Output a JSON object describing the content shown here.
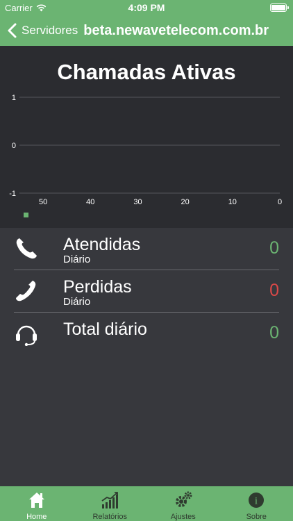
{
  "status": {
    "carrier": "Carrier",
    "time": "4:09 PM"
  },
  "nav": {
    "back_label": "Servidores",
    "title": "beta.newavetelecom.com.br"
  },
  "chart_data": {
    "type": "line",
    "title": "Chamadas Ativas",
    "x": [
      50,
      40,
      30,
      20,
      10,
      0
    ],
    "xticks": [
      "50",
      "40",
      "30",
      "20",
      "10",
      "0"
    ],
    "xlim": [
      55,
      0
    ],
    "ylim": [
      -1,
      1
    ],
    "yticks": [
      "1",
      "0",
      "-1"
    ],
    "series": [
      {
        "color": "#6bb472",
        "values": []
      }
    ],
    "grid": true,
    "legend": "bottom-left"
  },
  "stats": [
    {
      "label": "Atendidas",
      "sub": "Diário",
      "value": "0",
      "color": "green",
      "icon": "phone-icon"
    },
    {
      "label": "Perdidas",
      "sub": "Diário",
      "value": "0",
      "color": "red",
      "icon": "phone-missed-icon"
    },
    {
      "label": "Total diário",
      "sub": "",
      "value": "0",
      "color": "green",
      "icon": "headset-icon"
    }
  ],
  "tabs": [
    {
      "label": "Home",
      "icon": "home-icon",
      "active": true
    },
    {
      "label": "Relatórios",
      "icon": "chart-icon",
      "active": false
    },
    {
      "label": "Ajustes",
      "icon": "gears-icon",
      "active": false
    },
    {
      "label": "Sobre",
      "icon": "info-icon",
      "active": false
    }
  ],
  "colors": {
    "accent": "#6bb472",
    "background": "#37383d",
    "chart_bg": "#2b2c30",
    "missed": "#d94848"
  }
}
